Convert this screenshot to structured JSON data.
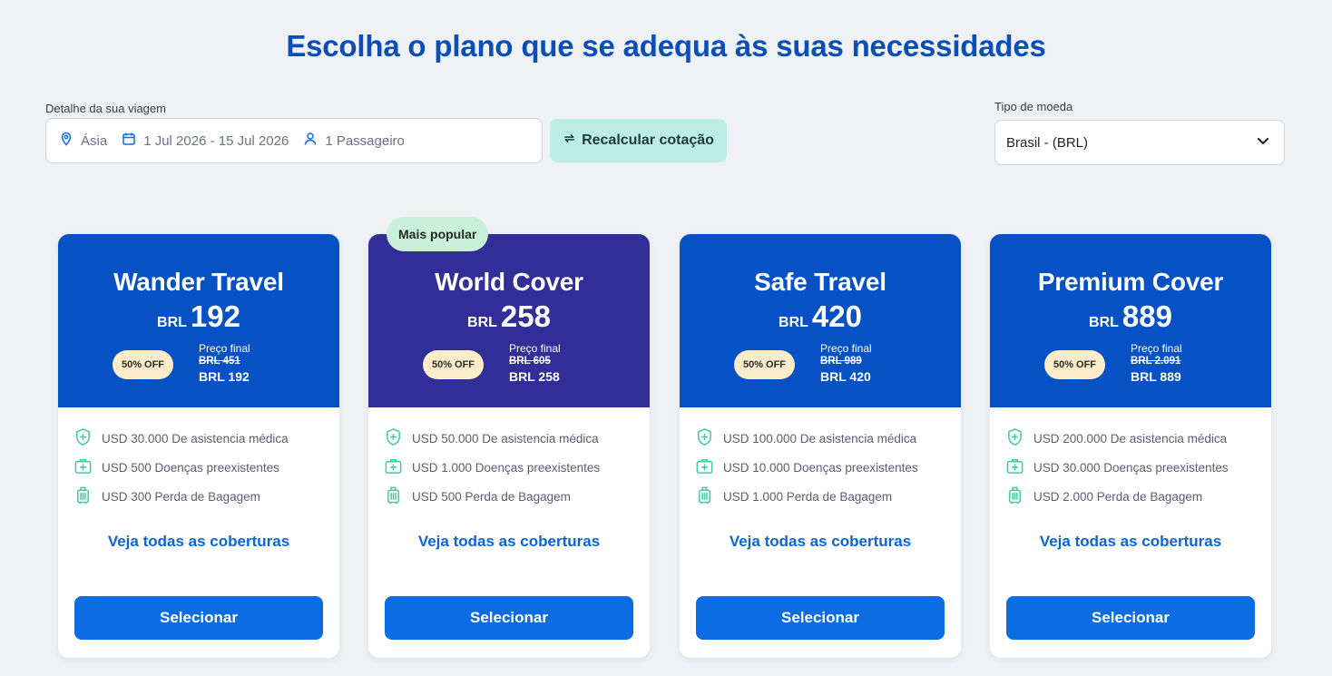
{
  "page": {
    "title": "Escolha o plano que se adequa às suas necessidades"
  },
  "trip": {
    "label": "Detalhe da sua viagem",
    "destination": "Ásia",
    "dates": "1 Jul 2026 - 15 Jul 2026",
    "passengers": "1 Passageiro",
    "recalc_label": "Recalcular cotação"
  },
  "currency": {
    "label": "Tipo de moeda",
    "selected": "Brasil - (BRL)"
  },
  "popular_badge": "Mais popular",
  "colors": {
    "primary": "#0652c5",
    "popular": "#312e97",
    "button": "#0b6ce3",
    "accent_icon": "#48c9a5",
    "title": "#0a4fb8"
  },
  "plans": [
    {
      "name": "Wander Travel",
      "currency": "BRL",
      "price": "192",
      "discount": "50% OFF",
      "final_label": "Preço final",
      "old_price": "BRL 451",
      "final_price": "BRL 192",
      "benefits": [
        "USD 30.000 De asistencia médica",
        "USD 500 Doenças preexistentes",
        "USD 300 Perda de Bagagem"
      ],
      "see_all": "Veja todas as coberturas",
      "select": "Selecionar"
    },
    {
      "name": "World Cover",
      "currency": "BRL",
      "price": "258",
      "discount": "50% OFF",
      "final_label": "Preço final",
      "old_price": "BRL 605",
      "final_price": "BRL 258",
      "benefits": [
        "USD 50.000 De asistencia médica",
        "USD 1.000 Doenças preexistentes",
        "USD 500 Perda de Bagagem"
      ],
      "see_all": "Veja todas as coberturas",
      "select": "Selecionar"
    },
    {
      "name": "Safe Travel",
      "currency": "BRL",
      "price": "420",
      "discount": "50% OFF",
      "final_label": "Preço final",
      "old_price": "BRL 989",
      "final_price": "BRL 420",
      "benefits": [
        "USD 100.000 De asistencia médica",
        "USD 10.000 Doenças preexistentes",
        "USD 1.000 Perda de Bagagem"
      ],
      "see_all": "Veja todas as coberturas",
      "select": "Selecionar"
    },
    {
      "name": "Premium Cover",
      "currency": "BRL",
      "price": "889",
      "discount": "50% OFF",
      "final_label": "Preço final",
      "old_price": "BRL 2.091",
      "final_price": "BRL 889",
      "benefits": [
        "USD 200.000 De asistencia médica",
        "USD 30.000 Doenças preexistentes",
        "USD 2.000 Perda de Bagagem"
      ],
      "see_all": "Veja todas as coberturas",
      "select": "Selecionar"
    }
  ]
}
